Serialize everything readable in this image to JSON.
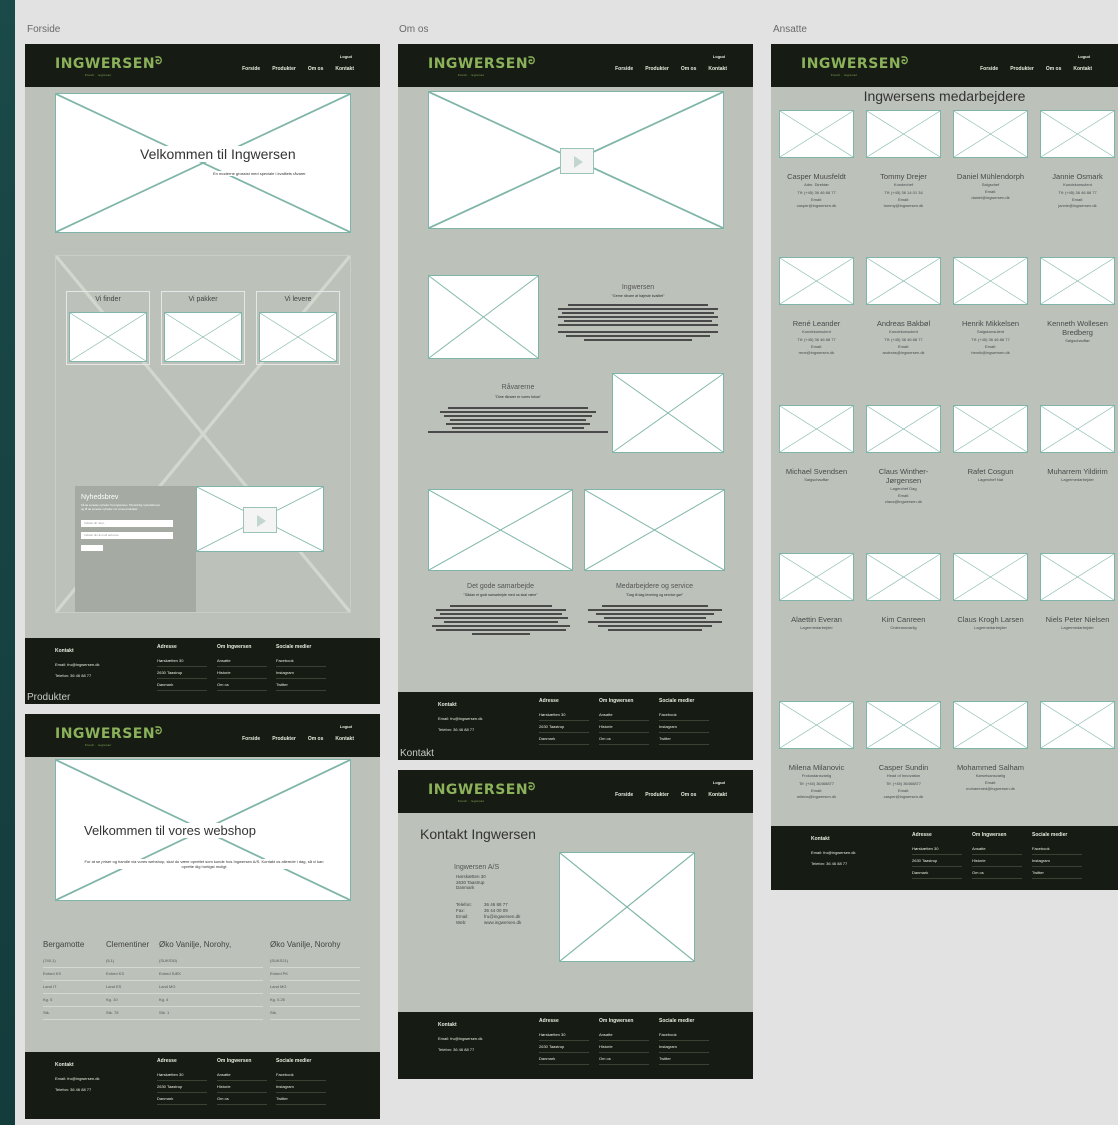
{
  "labels": {
    "forside": "Forside",
    "om_os": "Om os",
    "ansatte": "Ansatte",
    "produkter": "Produkter",
    "kontakt": "Kontakt"
  },
  "nav": {
    "logo": "INGWERSEN",
    "logo_sub": "Fresh · regional",
    "logout": "Logud",
    "items": [
      "Forside",
      "Produkter",
      "Om os",
      "Kontakt"
    ]
  },
  "forside": {
    "hero_title": "Velkommen til Ingwersen",
    "hero_sub": "En moderne grossist med speciale i kvalitets råvarer",
    "steps": [
      "Vi finder",
      "Vi pakker",
      "Vi levere"
    ],
    "newsletter_title": "Nyhedsbrev",
    "newsletter_text": "Få de seneste nyheder fra Ingwersen. Tilmeld dig nyhedsbrevet og få de seneste nyheder om vores produkter.",
    "name_placeholder": "Indtast dit navn",
    "email_placeholder": "Indtast din E-mail adresse"
  },
  "footer": {
    "contact_title": "Kontakt",
    "email": "Email: fru@ingwersen.dk",
    "phone": "Telefon: 36 46 88 77",
    "cols": [
      {
        "title": "Adresse",
        "rows": [
          "Hørskætten 30",
          "2630 Taastrup",
          "Danmark"
        ]
      },
      {
        "title": "Om Ingwersen",
        "rows": [
          "Ansatte",
          "Historie",
          "Om os"
        ]
      },
      {
        "title": "Sociale medier",
        "rows": [
          "Facebook",
          "Instagram",
          "Twitter"
        ]
      }
    ]
  },
  "om_os": {
    "section1_title": "Ingwersen",
    "section1_quote": "\"Gerne råvare af højeste kvalitet\"",
    "section2_title": "Råvarerne",
    "section2_quote": "\"Dine råvarer er vores fokus\"",
    "section3_title": "Det gode samarbejde",
    "section3_quote": "\"Sådan et godt samarbejde med os skal være\"",
    "section4_title": "Medarbejdere og service",
    "section4_quote": "\"Dag til dag levering og service gør\""
  },
  "ansatte": {
    "title": "Ingwersens medarbejdere",
    "employees": [
      {
        "name": "Casper Muusfeldt",
        "role": "Adm. Direktør",
        "tlf": "Tlf: (+45) 36 46 88 77",
        "email": "Email:",
        "email2": "casper@ingwersen.dk"
      },
      {
        "name": "Tommy Drejer",
        "role": "Kundechef",
        "tlf": "Tlf: (+45) 36 14 01 34",
        "email": "Email:",
        "email2": "tommy@ingwersen.dk"
      },
      {
        "name": "Daniel Mühlendorph",
        "role": "Salgschef",
        "tlf": "",
        "email": "Email:",
        "email2": "daniel@ingwersen.dk"
      },
      {
        "name": "Jannie Osmark",
        "role": "Kundekonsulent",
        "tlf": "Tlf: (+45) 36 46 88 77",
        "email": "Email:",
        "email2": "jannie@ingwersen.dk"
      },
      {
        "name": "René Leander",
        "role": "Kundekonsulent",
        "tlf": "Tlf: (+45) 36 46 88 77",
        "email": "Email:",
        "email2": "rene@ingwersen.dk"
      },
      {
        "name": "Andreas Bakbøl",
        "role": "Kundekonsulent",
        "tlf": "Tlf: (+45) 36 46 88 77",
        "email": "Email:",
        "email2": "andreas@ingwersen.dk"
      },
      {
        "name": "Henrik Mikkelsen",
        "role": "Salgskonsulent",
        "tlf": "Tlf: (+45) 36 46 88 77",
        "email": "Email:",
        "email2": "henrik@ingwersen.dk"
      },
      {
        "name": "Kenneth Wollesen Bredberg",
        "role": "Salgschauffør",
        "tlf": "",
        "email": "",
        "email2": ""
      },
      {
        "name": "Michael Svendsen",
        "role": "Salgschauffør",
        "tlf": "",
        "email": "",
        "email2": ""
      },
      {
        "name": "Claus Winther-Jørgensen",
        "role": "Lagerchef Dag",
        "tlf": "",
        "email": "Email:",
        "email2": "claus@ingwersen.dk"
      },
      {
        "name": "Rafet Cosgun",
        "role": "Lagerchef Nat",
        "tlf": "",
        "email": "",
        "email2": ""
      },
      {
        "name": "Muharrem Yildirim",
        "role": "Lagermedarbejder",
        "tlf": "",
        "email": "",
        "email2": ""
      },
      {
        "name": "Alaettin Everan",
        "role": "Lagermedarbejder",
        "tlf": "",
        "email": "",
        "email2": ""
      },
      {
        "name": "Kim Canreen",
        "role": "Ordreansvarlig",
        "tlf": "",
        "email": "",
        "email2": ""
      },
      {
        "name": "Claus Krogh Larsen",
        "role": "Lagermedarbejder",
        "tlf": "",
        "email": "",
        "email2": ""
      },
      {
        "name": "Niels Peter Nielsen",
        "role": "Lagermedarbejder",
        "tlf": "",
        "email": "",
        "email2": ""
      },
      {
        "name": "Milena Milanovic",
        "role": "Frokostansvarlig",
        "tlf": "Tlf: (+45) 36468877",
        "email": "Email:",
        "email2": "milena@ingwersen.dk"
      },
      {
        "name": "Casper Sundin",
        "role": "Head of Innovation",
        "tlf": "Tlf: (+45) 36468877",
        "email": "Email:",
        "email2": "casper@ingwersen.dk"
      },
      {
        "name": "Mohammed Salham",
        "role": "Kørselsansvarlig",
        "tlf": "",
        "email": "Email:",
        "email2": "mohammed@ingwersen.dk"
      },
      {
        "name": "",
        "role": "",
        "tlf": "",
        "email": "",
        "email2": ""
      }
    ]
  },
  "produkter": {
    "hero_title": "Velkommen til vores webshop",
    "hero_sub": "For at se priser og handle via vores webshop, skal du være oprettet som kunde hos Ingwersen A/S. Kontakt os allerede i dag, så vi kan oprette dig hurtigst muligt",
    "products": [
      {
        "name": "Bergamotte",
        "code": "(740,1)",
        "enhed": "Enhed  KS",
        "land": "Land  IT",
        "kg": "Kg.  5",
        "stk": "Stk."
      },
      {
        "name": "Clementiner",
        "code": "(5,1)",
        "enhed": "Enhed  KS",
        "land": "Land  ES",
        "kg": "Kg.  10",
        "stk": "Stk.  75"
      },
      {
        "name": "Øko Vanilje, Norohy,",
        "code": "(SUKS30)",
        "enhed": "Enhed  SÆK",
        "land": "Land  MG",
        "kg": "Kg.  4",
        "stk": "Stk.  1"
      },
      {
        "name": "Øko Vanilje, Norohy",
        "code": "(SUKS21)",
        "enhed": "Enhed  PK",
        "land": "Land  MG",
        "kg": "Kg.  0.25",
        "stk": "Stk."
      }
    ]
  },
  "kontakt": {
    "title": "Kontakt Ingwersen",
    "company": "Ingwersen A/S",
    "address": [
      "Hørskætten 30",
      "2630 Taastrup",
      "Danmark"
    ],
    "details": [
      [
        "Telefon:",
        "36 46 88 77"
      ],
      [
        "Fax:",
        "36 44 00 09"
      ],
      [
        "Email:",
        "fru@ingwersen.dk"
      ],
      [
        "Web:",
        "www.ingwersen.dk"
      ]
    ]
  },
  "colors": {
    "nav_bg": "#161b13",
    "page_bg": "#bcc1ba",
    "accent": "#8bb25a",
    "placeholder_stroke": "#7fb5a8"
  }
}
